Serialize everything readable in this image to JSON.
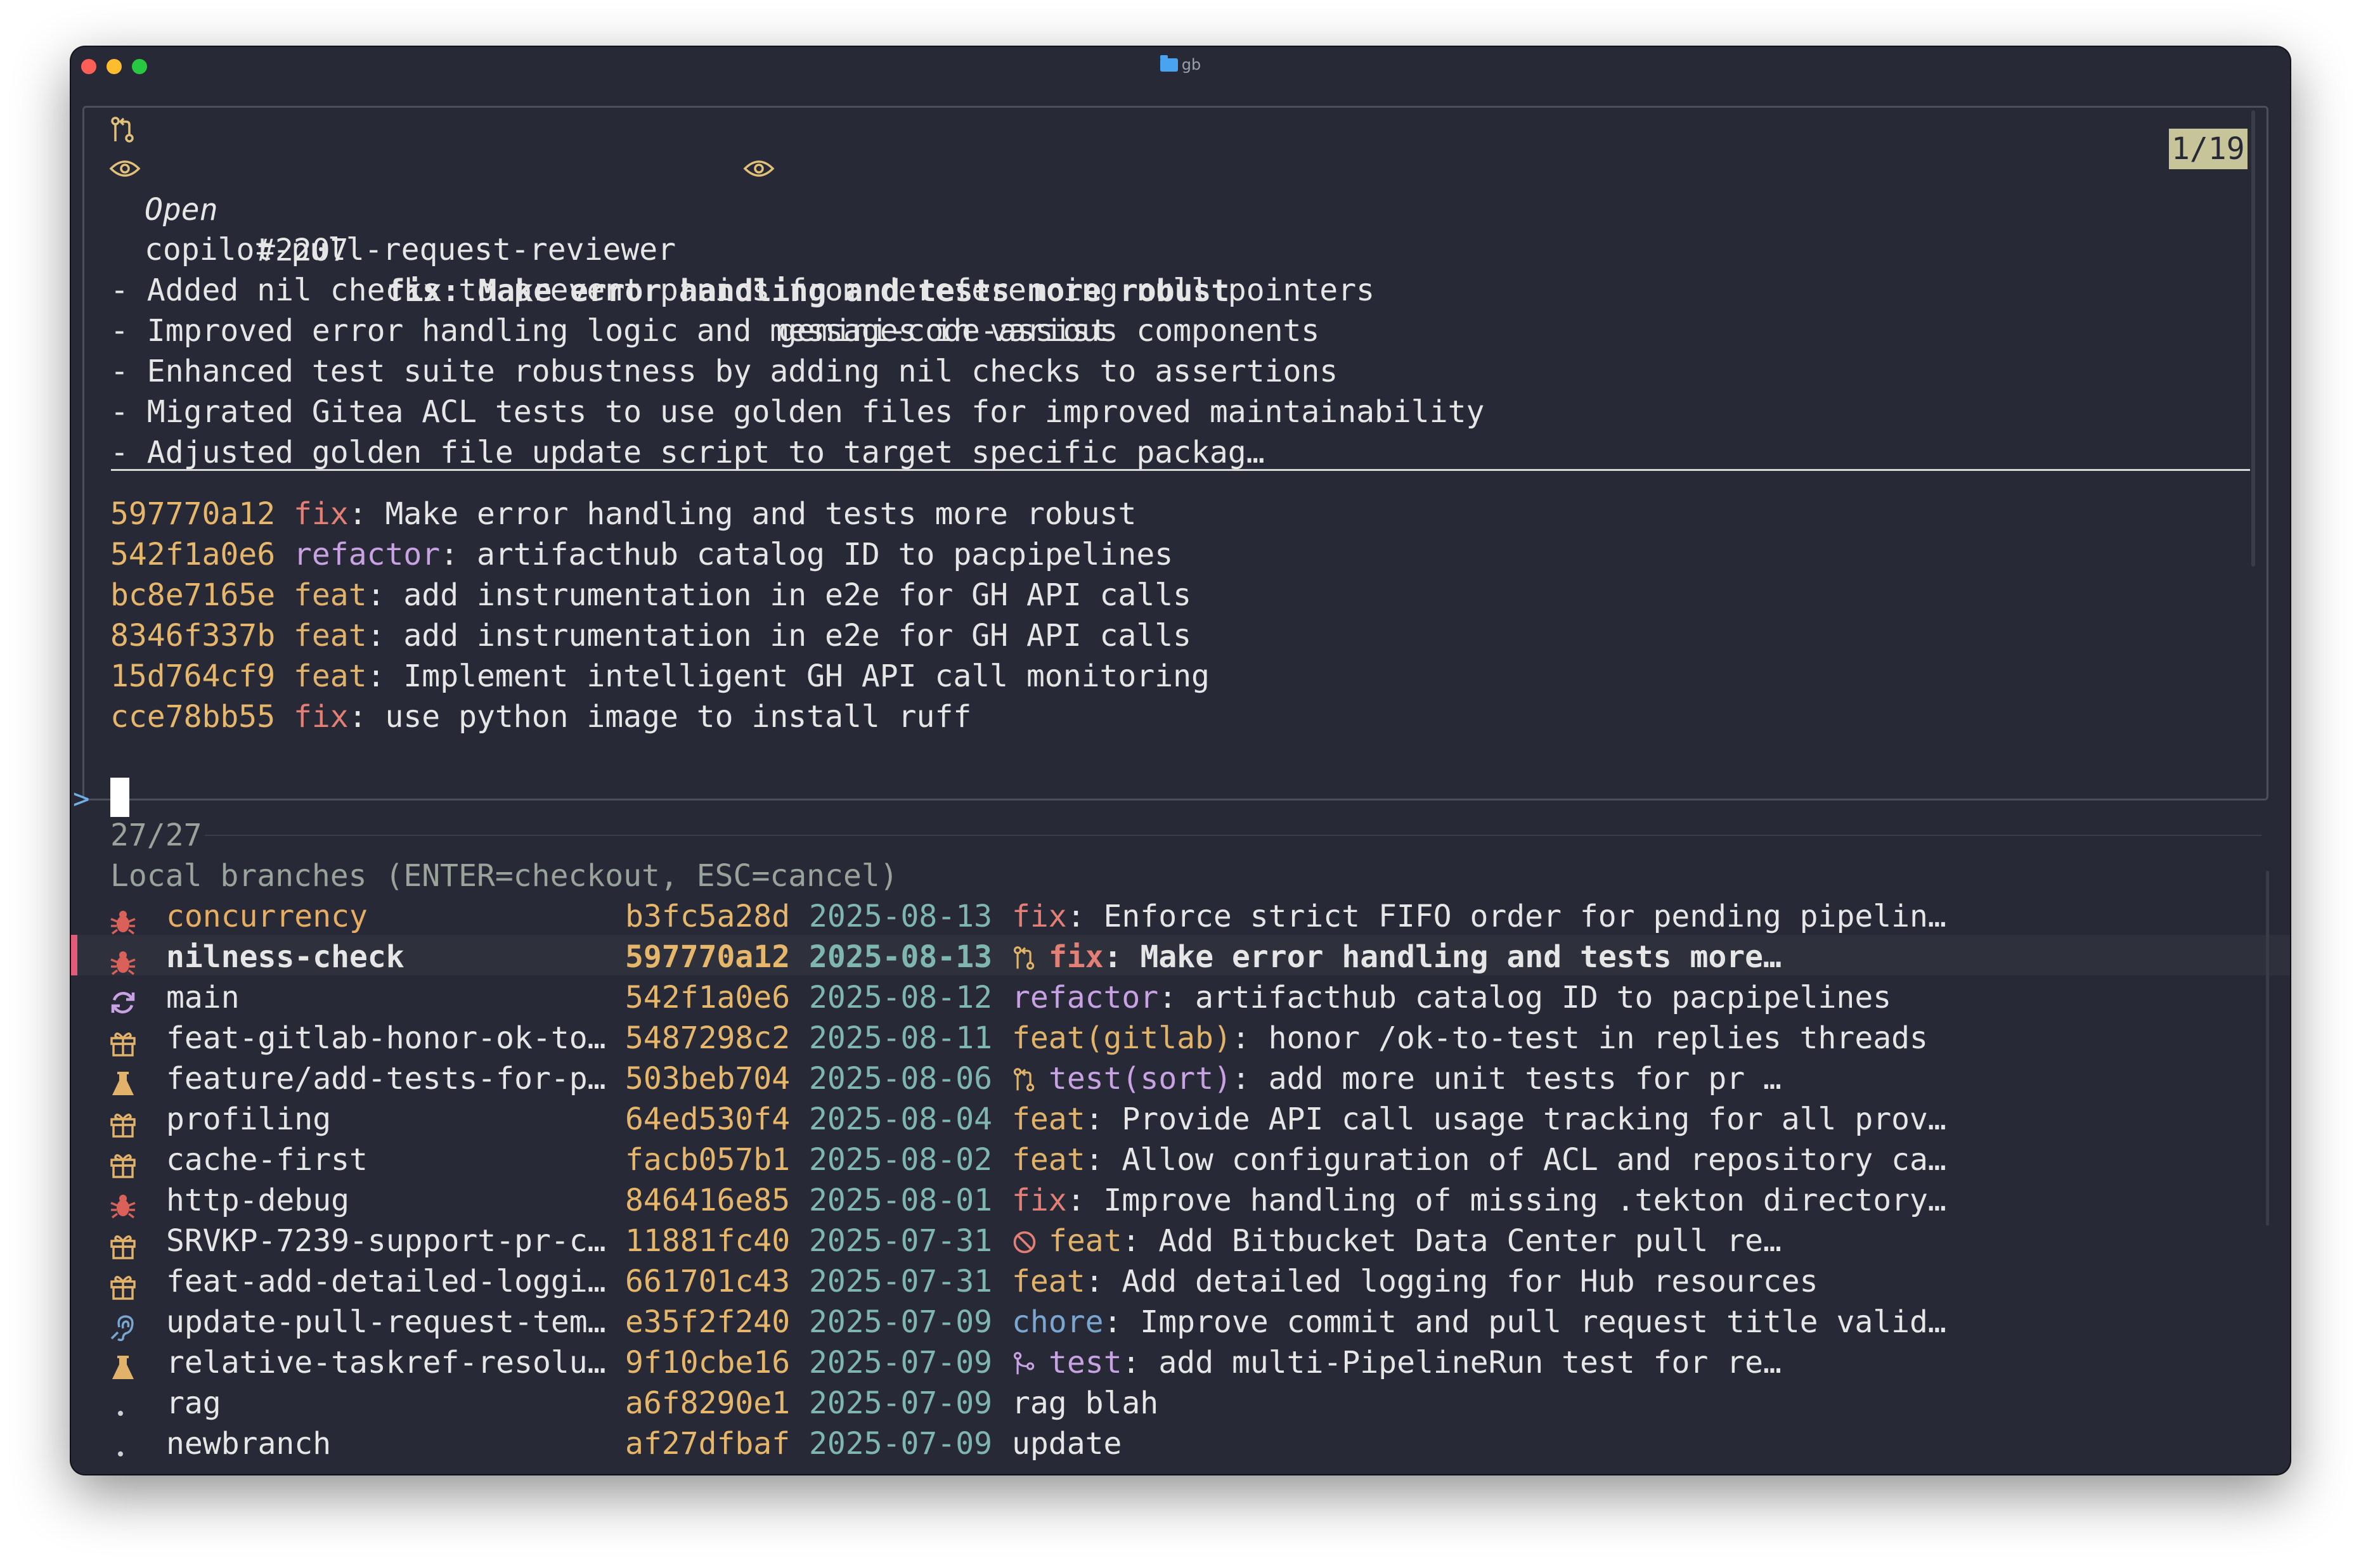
{
  "window": {
    "title": "gb"
  },
  "preview": {
    "state": "Open",
    "number": "#2207",
    "title": "fix: Make error handling and tests more robust",
    "counter": "1/19",
    "reviewers": [
      "copilot-pull-request-reviewer",
      "gemini-code-assist"
    ],
    "body": [
      "- Added nil checks to prevent panics from dereferencing null pointers",
      "- Improved error handling logic and messages in various components",
      "- Enhanced test suite robustness by adding nil checks to assertions",
      "- Migrated Gitea ACL tests to use golden files for improved maintainability",
      "- Adjusted golden file update script to target specific packag…"
    ],
    "commits": [
      {
        "hash": "597770a12",
        "type": "fix",
        "msg": ": Make error handling and tests more robust"
      },
      {
        "hash": "542f1a0e6",
        "type": "refactor",
        "msg": ": artifacthub catalog ID to pacpipelines"
      },
      {
        "hash": "bc8e7165e",
        "type": "feat",
        "msg": ": add instrumentation in e2e for GH API calls"
      },
      {
        "hash": "8346f337b",
        "type": "feat",
        "msg": ": add instrumentation in e2e for GH API calls"
      },
      {
        "hash": "15d764cf9",
        "type": "feat",
        "msg": ": Implement intelligent GH API call monitoring"
      },
      {
        "hash": "cce78bb55",
        "type": "fix",
        "msg": ": use python image to install ruff"
      }
    ]
  },
  "prompt": {
    "symbol": ">",
    "count": "27/27",
    "header": "Local branches (ENTER=checkout, ESC=cancel)"
  },
  "branches": [
    {
      "icon": "bug",
      "name": "concurrency",
      "hash": "b3fc5a28d",
      "date": "2025-08-13",
      "badge": "",
      "type": "fix",
      "msg": ": Enforce strict FIFO order for pending pipelin…",
      "selected": false
    },
    {
      "icon": "bug",
      "name": "nilness-check",
      "hash": "597770a12",
      "date": "2025-08-13",
      "badge": "pr",
      "type": "fix",
      "msg": ": Make error handling and tests more…",
      "selected": true
    },
    {
      "icon": "refresh",
      "name": "main",
      "hash": "542f1a0e6",
      "date": "2025-08-12",
      "badge": "",
      "type": "refactor",
      "msg": ": artifacthub catalog ID to pacpipelines",
      "selected": false
    },
    {
      "icon": "gift",
      "name": "feat-gitlab-honor-ok-to…",
      "hash": "5487298c2",
      "date": "2025-08-11",
      "badge": "",
      "type": "feat(gitlab)",
      "msg": ": honor /ok-to-test in replies threads",
      "selected": false
    },
    {
      "icon": "flask",
      "name": "feature/add-tests-for-p…",
      "hash": "503beb704",
      "date": "2025-08-06",
      "badge": "pr",
      "type": "test(sort)",
      "msg": ": add more unit tests for pr …",
      "selected": false
    },
    {
      "icon": "gift",
      "name": "profiling",
      "hash": "64ed530f4",
      "date": "2025-08-04",
      "badge": "",
      "type": "feat",
      "msg": ": Provide API call usage tracking for all prov…",
      "selected": false
    },
    {
      "icon": "gift",
      "name": "cache-first",
      "hash": "facb057b1",
      "date": "2025-08-02",
      "badge": "",
      "type": "feat",
      "msg": ": Allow configuration of ACL and repository ca…",
      "selected": false
    },
    {
      "icon": "bug",
      "name": "http-debug",
      "hash": "846416e85",
      "date": "2025-08-01",
      "badge": "",
      "type": "fix",
      "msg": ": Improve handling of missing .tekton directory…",
      "selected": false
    },
    {
      "icon": "gift",
      "name": "SRVKP-7239-support-pr-c…",
      "hash": "11881fc40",
      "date": "2025-07-31",
      "badge": "closed",
      "type": "feat",
      "msg": ": Add Bitbucket Data Center pull re…",
      "selected": false
    },
    {
      "icon": "gift",
      "name": "feat-add-detailed-loggi…",
      "hash": "661701c43",
      "date": "2025-07-31",
      "badge": "",
      "type": "feat",
      "msg": ": Add detailed logging for Hub resources",
      "selected": false
    },
    {
      "icon": "ear",
      "name": "update-pull-request-tem…",
      "hash": "e35f2f240",
      "date": "2025-07-09",
      "badge": "",
      "type": "chore",
      "msg": ": Improve commit and pull request title valid…",
      "selected": false
    },
    {
      "icon": "flask",
      "name": "relative-taskref-resolu…",
      "hash": "9f10cbe16",
      "date": "2025-07-09",
      "badge": "merged",
      "type": "test",
      "msg": ": add multi-PipelineRun test for re…",
      "selected": false
    },
    {
      "icon": "dot",
      "name": "rag",
      "hash": "a6f8290e1",
      "date": "2025-07-09",
      "badge": "",
      "type": "",
      "msg": "rag blah",
      "selected": false
    },
    {
      "icon": "dot",
      "name": "newbranch",
      "hash": "af27dfbaf",
      "date": "2025-07-09",
      "badge": "",
      "type": "",
      "msg": "update",
      "selected": false
    }
  ],
  "colors": {
    "background": "#272a36",
    "hash": "#e6b66a",
    "date": "#7fb6b0",
    "fix": "#e37f75",
    "feat": "#e1b36a",
    "refactor": "#c9a2e3",
    "chore": "#79a7d2",
    "selection_marker": "#e25c79"
  }
}
